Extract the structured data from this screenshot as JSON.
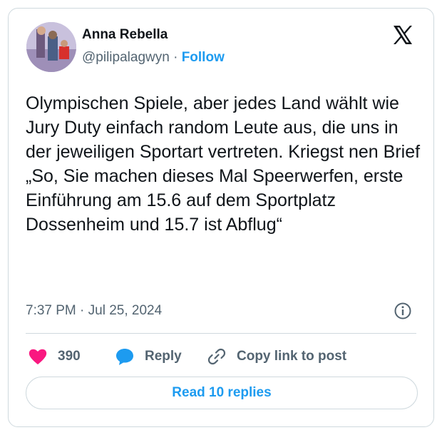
{
  "author": {
    "name": "Anna Rebella",
    "handle": "@pilipalagwyn",
    "separator": "·",
    "follow_label": "Follow"
  },
  "tweet": {
    "text": "Olympischen Spiele, aber jedes Land wählt wie Jury Duty einfach random Leute aus, die uns in der jeweiligen Sportart vertreten. Kriegst nen Brief „So, Sie machen dieses Mal Speerwerfen, erste Einführung am 15.6 auf dem Sportplatz Dossenheim und 15.7 ist Abflug“",
    "timestamp": "7:37 PM · Jul 25, 2024"
  },
  "actions": {
    "like_count": "390",
    "reply_label": "Reply",
    "copy_label": "Copy link to post"
  },
  "footer": {
    "read_replies_label": "Read 10 replies"
  },
  "colors": {
    "accent": "#1d9bf0",
    "like": "#f91880",
    "text": "#0f1419",
    "secondary": "#536471",
    "border": "#cfd9de"
  },
  "icons": [
    "x-logo-icon",
    "info-icon",
    "heart-icon",
    "reply-bubble-icon",
    "link-icon"
  ]
}
